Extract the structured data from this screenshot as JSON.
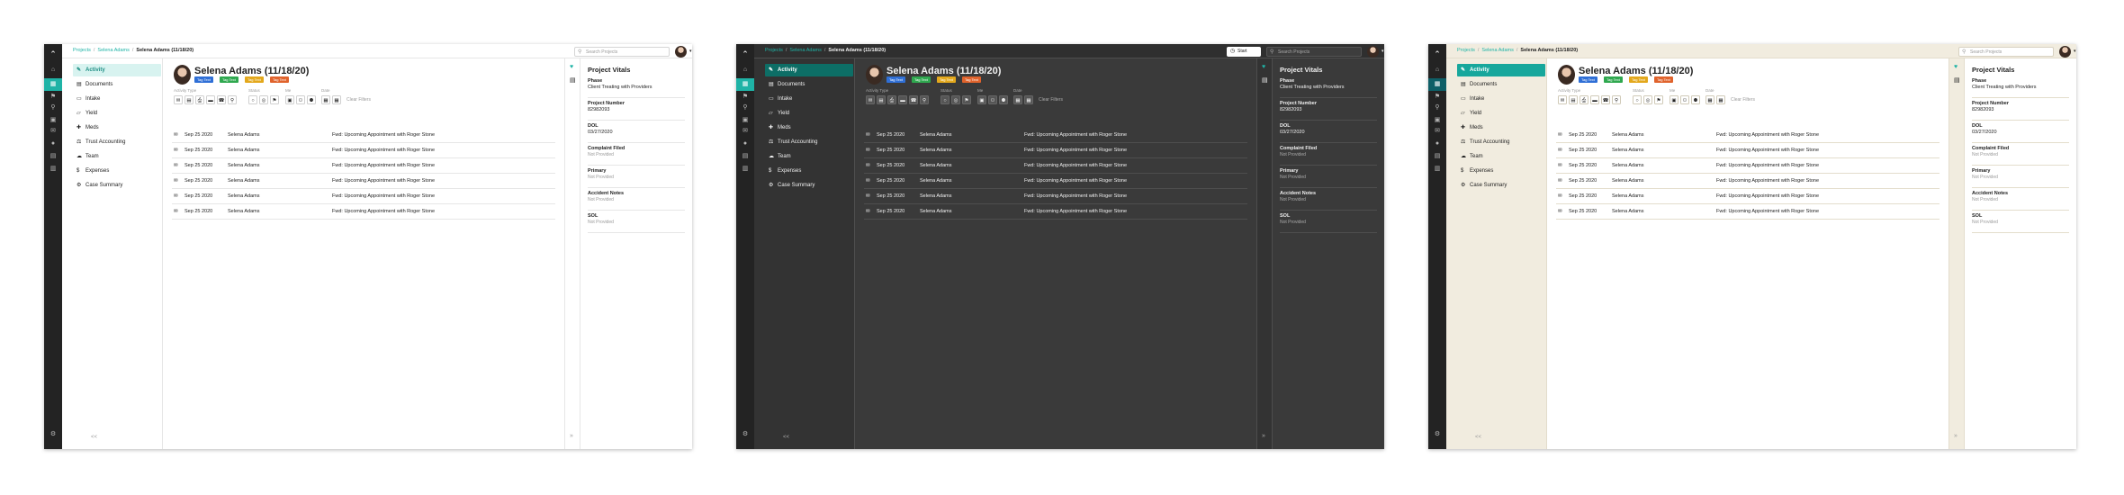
{
  "breadcrumb": [
    "Projects",
    "Selena Adams",
    "Selena Adams (11/18/20)"
  ],
  "search_placeholder": "Search Projects",
  "start_button": "Start",
  "nav": [
    "Activity",
    "Documents",
    "Intake",
    "Yield",
    "Meds",
    "Trust Accounting",
    "Team",
    "Expenses",
    "Case Summary"
  ],
  "nav_collapse": "<<",
  "person": {
    "name": "Selena Adams (11/18/20)",
    "tags": [
      {
        "label": "Tag Text",
        "color": "#2f6fd6"
      },
      {
        "label": "Tag Text",
        "color": "#2fa84f"
      },
      {
        "label": "Tag Text",
        "color": "#e3a81c"
      },
      {
        "label": "Tag Text",
        "color": "#e0632c"
      }
    ]
  },
  "filters": {
    "labels": [
      "Activity Type",
      "Status",
      "Me",
      "Date"
    ],
    "clear": "Clear Filters"
  },
  "rows": [
    {
      "date": "Sep 25 2020",
      "name": "Selena Adams",
      "text": "Fwd: Upcoming Appointment with Roger Stone"
    },
    {
      "date": "Sep 25 2020",
      "name": "Selena Adams",
      "text": "Fwd: Upcoming Appointment with Roger Stone"
    },
    {
      "date": "Sep 25 2020",
      "name": "Selena Adams",
      "text": "Fwd: Upcoming Appointment with Roger Stone"
    },
    {
      "date": "Sep 25 2020",
      "name": "Selena Adams",
      "text": "Fwd: Upcoming Appointment with Roger Stone"
    },
    {
      "date": "Sep 25 2020",
      "name": "Selena Adams",
      "text": "Fwd: Upcoming Appointment with Roger Stone"
    },
    {
      "date": "Sep 25 2020",
      "name": "Selena Adams",
      "text": "Fwd: Upcoming Appointment with Roger Stone"
    }
  ],
  "vitals": {
    "title": "Project Vitals",
    "items": [
      {
        "label": "Phase",
        "value": "Client Treating with Providers",
        "muted": false
      },
      {
        "label": "Project Number",
        "value": "82982093",
        "muted": false
      },
      {
        "label": "DOL",
        "value": "03/27/2020",
        "muted": false
      },
      {
        "label": "Complaint Filed",
        "value": "Not Provided",
        "muted": true
      },
      {
        "label": "Primary",
        "value": "Not Provided",
        "muted": true
      },
      {
        "label": "Accident Notes",
        "value": "Not Provided",
        "muted": true
      },
      {
        "label": "SOL",
        "value": "Not Provided",
        "muted": true
      }
    ]
  },
  "themes": [
    {
      "key": "light",
      "accent": "#1fb3a6",
      "panel_bg": "#ffffff",
      "topbar_bg": "#ffffff",
      "nav_bg": "#ffffff",
      "text": "#222222",
      "muted_text": "#9a9a9a",
      "border": "#e6e6e6",
      "crumb_link": "#1fb3a6",
      "search_bg": "#ffffff",
      "search_border": "#d5d5d5",
      "button_bg": "#ffffff",
      "button_border": "#d0d0d0",
      "active_nav_bg": "#d8f3f0",
      "active_nav_text": "#1f8f85",
      "rail_active_bg": "#1fb3a6",
      "show_start": false
    },
    {
      "key": "dark",
      "accent": "#1fb3a6",
      "panel_bg": "#3a3a3a",
      "topbar_bg": "#2f2f2f",
      "nav_bg": "#333333",
      "text": "#f0f0f0",
      "muted_text": "#aaaaaa",
      "border": "#4e4e4e",
      "crumb_link": "#1fb3a6",
      "search_bg": "#3d3d3d",
      "search_border": "#555555",
      "button_bg": "#555555",
      "button_border": "#666666",
      "active_nav_bg": "#0d6e66",
      "active_nav_text": "#ffffff",
      "rail_active_bg": "#1fb3a6",
      "show_start": true
    },
    {
      "key": "cream",
      "accent": "#1fb3a6",
      "panel_bg": "#ffffff",
      "topbar_bg": "#f1ecdf",
      "nav_bg": "#f1ecdf",
      "text": "#222222",
      "muted_text": "#9a9a9a",
      "border": "#e3ddcc",
      "crumb_link": "#1fb3a6",
      "search_bg": "#ffffff",
      "search_border": "#d8d2c2",
      "button_bg": "#ffffff",
      "button_border": "#d0cab8",
      "active_nav_bg": "#17a79c",
      "active_nav_text": "#ffffff",
      "rail_active_bg": "#0e5f67",
      "show_start": false
    }
  ]
}
